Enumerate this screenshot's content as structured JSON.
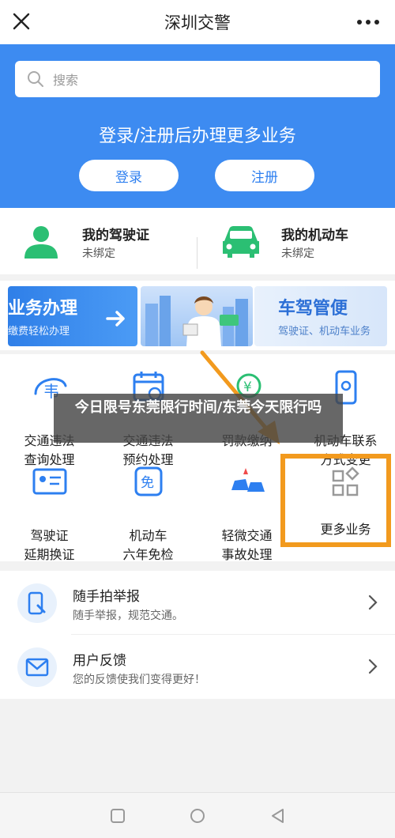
{
  "header": {
    "title": "深圳交警"
  },
  "search": {
    "placeholder": "搜索"
  },
  "hero": {
    "headline": "登录/注册后办理更多业务",
    "login_label": "登录",
    "register_label": "注册"
  },
  "licenses": [
    {
      "name": "我的驾驶证",
      "status": "未绑定",
      "icon": "person-icon"
    },
    {
      "name": "我的机动车",
      "status": "未绑定",
      "icon": "car-icon"
    }
  ],
  "banners": {
    "left": {
      "title": "业务办理",
      "subtitle": "缴费轻松办理"
    },
    "right": {
      "title": "车驾管便",
      "subtitle": "驾驶证、机动车业务"
    }
  },
  "services": [
    {
      "label": "交通违法\n查询处理",
      "icon": "violation-icon"
    },
    {
      "label": "交通违法\n预约处理",
      "icon": "calendar-icon"
    },
    {
      "label": "罚款缴纳",
      "icon": "fine-icon"
    },
    {
      "label": "机动车联系\n方式变更",
      "icon": "phone-icon"
    },
    {
      "label": "驾驶证\n延期换证",
      "icon": "id-card-icon"
    },
    {
      "label": "机动车\n六年免检",
      "icon": "exempt-icon"
    },
    {
      "label": "轻微交通\n事故处理",
      "icon": "accident-icon"
    },
    {
      "label": "更多业务",
      "icon": "grid-icon"
    }
  ],
  "list": [
    {
      "title": "随手拍举报",
      "subtitle": "随手举报，规范交通。",
      "icon": "report-icon"
    },
    {
      "title": "用户反馈",
      "subtitle": "您的反馈使我们变得更好！",
      "icon": "mail-icon"
    }
  ],
  "overlay": {
    "caption": "今日限号东莞限行时间/东莞今天限行吗"
  },
  "colors": {
    "primary": "#3d8bf1",
    "accent_green": "#2bbf73",
    "highlight": "#f29a1e"
  }
}
